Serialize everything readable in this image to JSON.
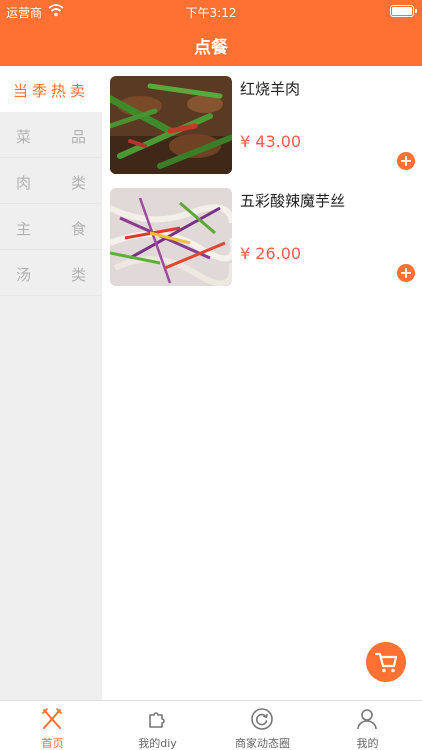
{
  "status_bar": {
    "carrier": "运营商",
    "time": "下午3:12"
  },
  "navbar": {
    "title": "点餐"
  },
  "categories": [
    {
      "label": "当季热卖",
      "c1": "当季热卖",
      "c2": "",
      "active": true
    },
    {
      "label": "菜品",
      "c1": "菜",
      "c2": "品",
      "active": false
    },
    {
      "label": "肉类",
      "c1": "肉",
      "c2": "类",
      "active": false
    },
    {
      "label": "主食",
      "c1": "主",
      "c2": "食",
      "active": false
    },
    {
      "label": "汤类",
      "c1": "汤",
      "c2": "类",
      "active": false
    }
  ],
  "dishes": [
    {
      "name": "红烧羊肉",
      "price": "¥ 43.00"
    },
    {
      "name": "五彩酸辣魔芋丝",
      "price": "¥ 26.00"
    }
  ],
  "tabbar": {
    "items": [
      {
        "label": "首页",
        "icon": "utensils-icon",
        "active": true
      },
      {
        "label": "我的diy",
        "icon": "puzzle-icon",
        "active": false
      },
      {
        "label": "商家动态圈",
        "icon": "refresh-circle-icon",
        "active": false
      },
      {
        "label": "我的",
        "icon": "user-icon",
        "active": false
      }
    ]
  },
  "colors": {
    "accent": "#ff7033",
    "price": "#ff5a4d",
    "sidebar_bg": "#efefef",
    "inactive_text": "#b2b2b2"
  }
}
